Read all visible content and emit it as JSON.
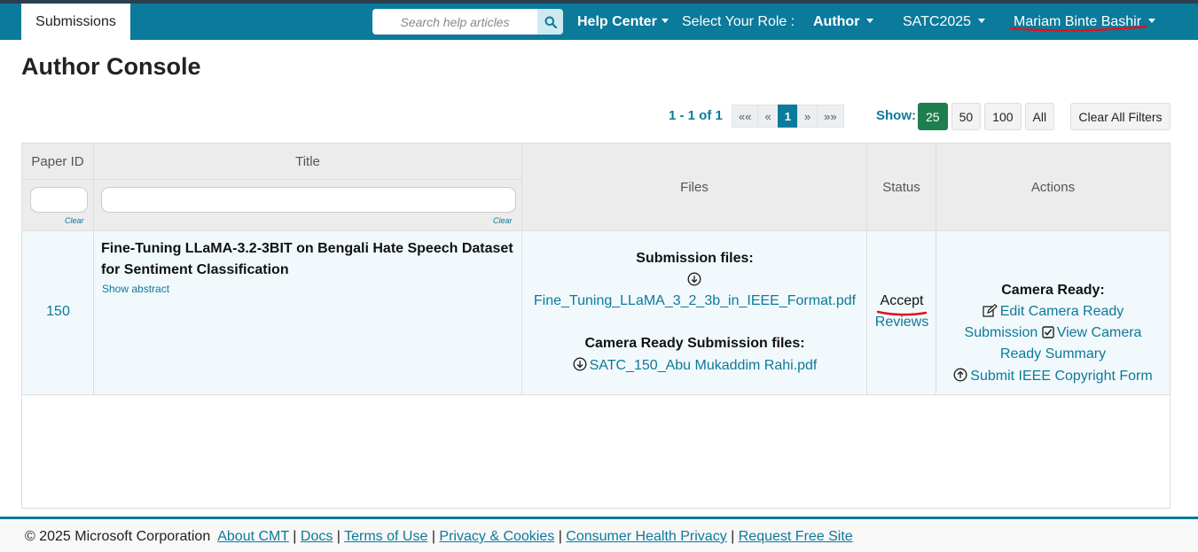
{
  "nav": {
    "tab_submissions": "Submissions",
    "search_placeholder": "Search help articles",
    "help_center": "Help Center",
    "select_role_label": "Select Your Role :",
    "role": "Author",
    "conference": "SATC2025",
    "user": "Mariam Binte Bashir"
  },
  "page": {
    "title": "Author Console"
  },
  "pager": {
    "info": "1 - 1 of 1",
    "first": "««",
    "prev": "«",
    "current": "1",
    "next": "»",
    "last": "»»",
    "show_label": "Show:",
    "sizes": [
      "25",
      "50",
      "100",
      "All"
    ],
    "active_size": "25",
    "clear_filters": "Clear All Filters"
  },
  "table": {
    "headers": {
      "paper_id": "Paper ID",
      "title": "Title",
      "files": "Files",
      "status": "Status",
      "actions": "Actions"
    },
    "clear_label": "Clear",
    "row": {
      "paper_id": "150",
      "title": "Fine-Tuning LLaMA-3.2-3BIT on Bengali Hate Speech Dataset for Sentiment Classification",
      "show_abstract": "Show abstract",
      "submission_files_label": "Submission files:",
      "submission_file": "Fine_Tuning_LLaMA_3_2_3b_in_IEEE_Format.pdf",
      "camera_ready_files_label": "Camera Ready Submission files:",
      "camera_ready_file": "SATC_150_Abu Mukaddim Rahi.pdf",
      "status": "Accept",
      "reviews": "Reviews",
      "camera_ready_label": "Camera Ready:",
      "edit_camera_ready_1": "Edit Camera Ready",
      "edit_camera_ready_2": "Submission",
      "view_camera_ready_1": "View Camera",
      "view_camera_ready_2": "Ready Summary",
      "copyright": "Submit IEEE Copyright Form"
    }
  },
  "footer": {
    "copyright": "© 2025 Microsoft Corporation",
    "links": [
      "About CMT",
      "Docs",
      "Terms of Use",
      "Privacy & Cookies",
      "Consumer Health Privacy",
      "Request Free Site"
    ]
  },
  "colors": {
    "brand": "#0b7a9b",
    "active_green": "#1e7e4e",
    "annotation_red": "#e0141e"
  }
}
